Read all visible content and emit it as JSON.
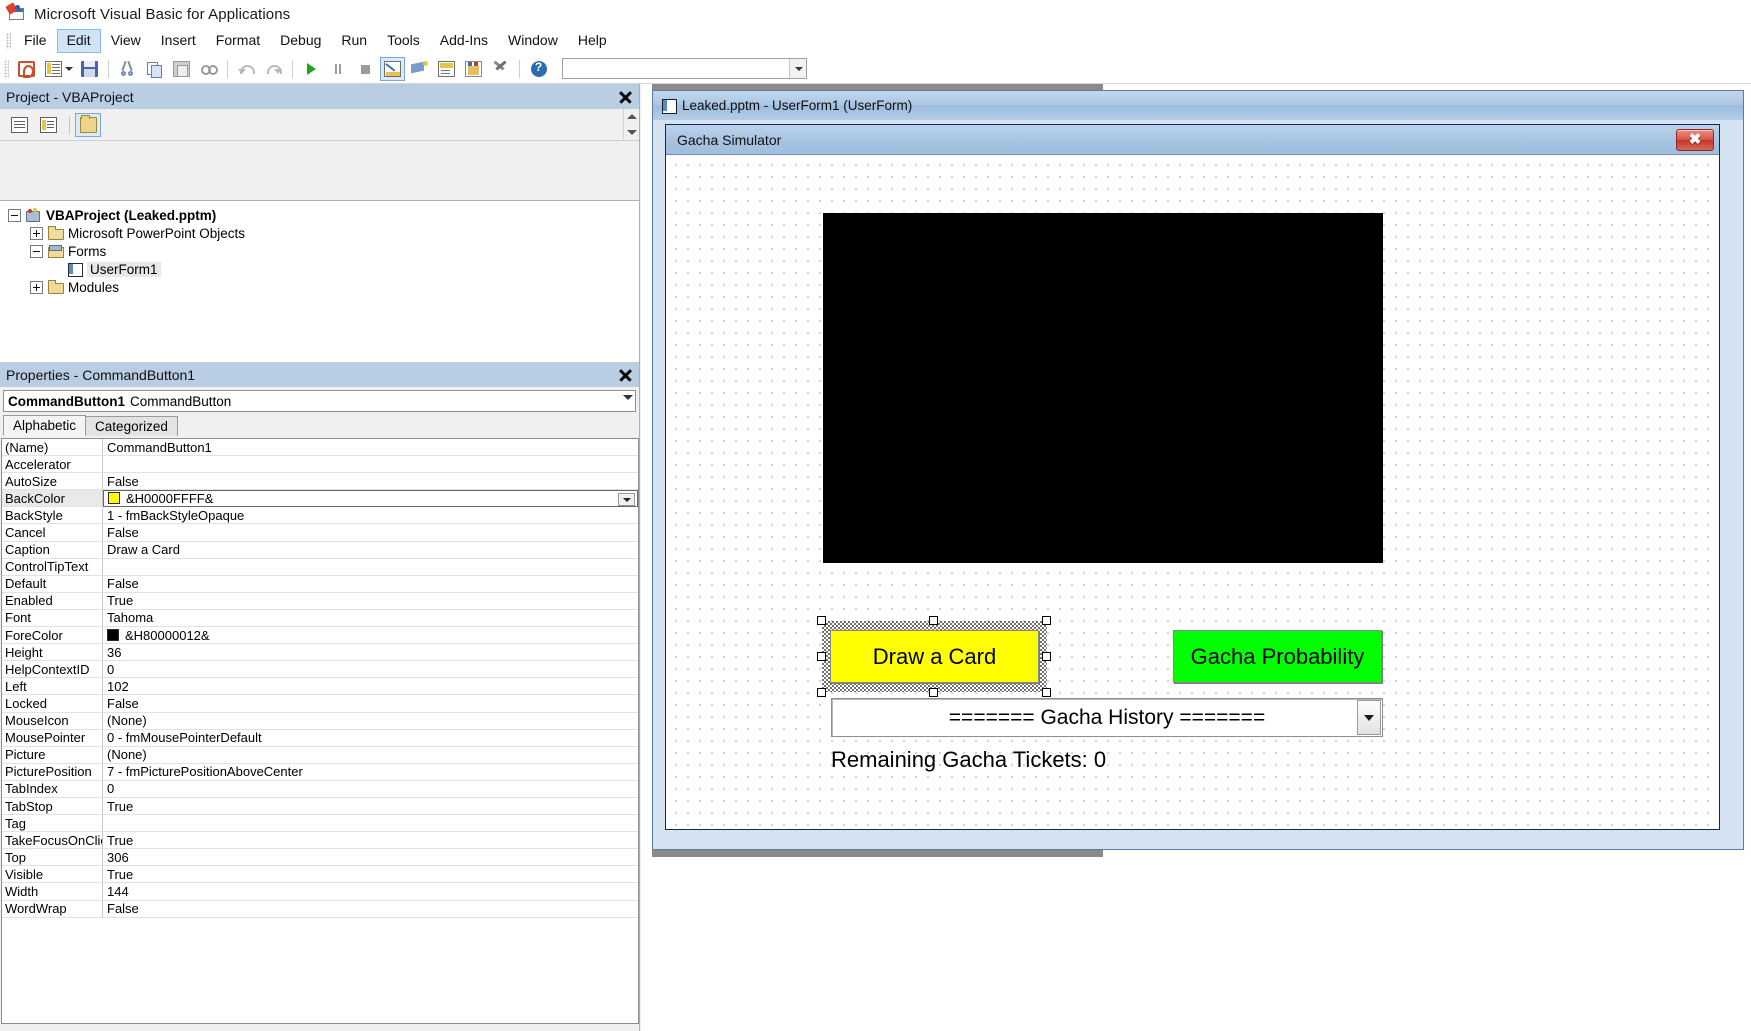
{
  "app": {
    "title": "Microsoft Visual Basic for Applications",
    "icon": "vba-app-icon"
  },
  "menubar": {
    "items": [
      {
        "label": "File"
      },
      {
        "label": "Edit",
        "active": true
      },
      {
        "label": "View"
      },
      {
        "label": "Insert"
      },
      {
        "label": "Format"
      },
      {
        "label": "Debug"
      },
      {
        "label": "Run"
      },
      {
        "label": "Tools"
      },
      {
        "label": "Add-Ins"
      },
      {
        "label": "Window"
      },
      {
        "label": "Help"
      }
    ]
  },
  "toolbar": {
    "buttons": [
      {
        "icon": "powerpoint-view-icon"
      },
      {
        "icon": "insert-userform-icon"
      },
      {
        "icon": "insert-dropdown-caret-icon"
      },
      {
        "icon": "save-icon"
      },
      {
        "icon": "cut-icon"
      },
      {
        "icon": "copy-icon"
      },
      {
        "icon": "paste-icon"
      },
      {
        "icon": "find-icon"
      },
      {
        "icon": "undo-icon"
      },
      {
        "icon": "redo-icon"
      },
      {
        "icon": "run-icon"
      },
      {
        "icon": "pause-icon"
      },
      {
        "icon": "stop-icon"
      },
      {
        "icon": "design-mode-icon",
        "selected": true
      },
      {
        "icon": "project-explorer-icon"
      },
      {
        "icon": "properties-window-icon"
      },
      {
        "icon": "object-browser-icon"
      },
      {
        "icon": "toolbox-icon"
      },
      {
        "icon": "help-icon"
      }
    ],
    "combo_value": ""
  },
  "project_panel": {
    "title": "Project - VBAProject",
    "close_label": "close-panel",
    "toolbar": [
      {
        "icon": "view-code-icon"
      },
      {
        "icon": "view-object-icon"
      },
      {
        "icon": "toggle-folders-icon",
        "selected": true
      }
    ],
    "tree": [
      {
        "label": "VBAProject (Leaked.pptm)",
        "icon": "project-icon",
        "expander": "minus",
        "depth": 0,
        "bold": true
      },
      {
        "label": "Microsoft PowerPoint Objects",
        "icon": "folder-icon",
        "expander": "plus",
        "depth": 1,
        "bold": false
      },
      {
        "label": "Forms",
        "icon": "forms-folder-icon",
        "expander": "minus",
        "depth": 1,
        "bold": false
      },
      {
        "label": "UserForm1",
        "icon": "userform-icon",
        "expander": "none",
        "depth": 2,
        "bold": false,
        "selected": true
      },
      {
        "label": "Modules",
        "icon": "folder-icon",
        "expander": "plus",
        "depth": 1,
        "bold": false
      }
    ]
  },
  "properties_panel": {
    "title": "Properties - CommandButton1",
    "close_label": "close-panel",
    "object_name": "CommandButton1",
    "object_type": "CommandButton",
    "tabs": [
      {
        "label": "Alphabetic",
        "active": true
      },
      {
        "label": "Categorized",
        "active": false
      }
    ],
    "rows": [
      {
        "name": "(Name)",
        "value": "CommandButton1"
      },
      {
        "name": "Accelerator",
        "value": ""
      },
      {
        "name": "AutoSize",
        "value": "False"
      },
      {
        "name": "BackColor",
        "value": "&H0000FFFF&",
        "swatch": "#ffff00",
        "selected": true,
        "dropdown": true
      },
      {
        "name": "BackStyle",
        "value": "1 - fmBackStyleOpaque"
      },
      {
        "name": "Cancel",
        "value": "False"
      },
      {
        "name": "Caption",
        "value": "Draw a Card"
      },
      {
        "name": "ControlTipText",
        "value": ""
      },
      {
        "name": "Default",
        "value": "False"
      },
      {
        "name": "Enabled",
        "value": "True"
      },
      {
        "name": "Font",
        "value": "Tahoma"
      },
      {
        "name": "ForeColor",
        "value": "&H80000012&",
        "swatch": "#000000"
      },
      {
        "name": "Height",
        "value": "36"
      },
      {
        "name": "HelpContextID",
        "value": "0"
      },
      {
        "name": "Left",
        "value": "102"
      },
      {
        "name": "Locked",
        "value": "False"
      },
      {
        "name": "MouseIcon",
        "value": "(None)"
      },
      {
        "name": "MousePointer",
        "value": "0 - fmMousePointerDefault"
      },
      {
        "name": "Picture",
        "value": "(None)"
      },
      {
        "name": "PicturePosition",
        "value": "7 - fmPicturePositionAboveCenter"
      },
      {
        "name": "TabIndex",
        "value": "0"
      },
      {
        "name": "TabStop",
        "value": "True"
      },
      {
        "name": "Tag",
        "value": ""
      },
      {
        "name": "TakeFocusOnClick",
        "value": "True"
      },
      {
        "name": "Top",
        "value": "306"
      },
      {
        "name": "Visible",
        "value": "True"
      },
      {
        "name": "Width",
        "value": "144"
      },
      {
        "name": "WordWrap",
        "value": "False"
      }
    ]
  },
  "designer": {
    "window_title": "Leaked.pptm - UserForm1 (UserForm)",
    "window_icon": "userform-icon",
    "userform": {
      "caption": "Gacha Simulator",
      "close_button_label": "✖",
      "controls": {
        "image": {
          "name": "Image1",
          "background": "#000000"
        },
        "draw_button": {
          "caption": "Draw a Card",
          "backcolor": "#ffff00",
          "selected": true
        },
        "probability_button": {
          "caption": "Gacha Probability",
          "backcolor": "#00ff00"
        },
        "history_combo": {
          "value": "======= Gacha History ======="
        },
        "tickets_label": {
          "caption": "Remaining Gacha Tickets: 0"
        }
      }
    }
  }
}
